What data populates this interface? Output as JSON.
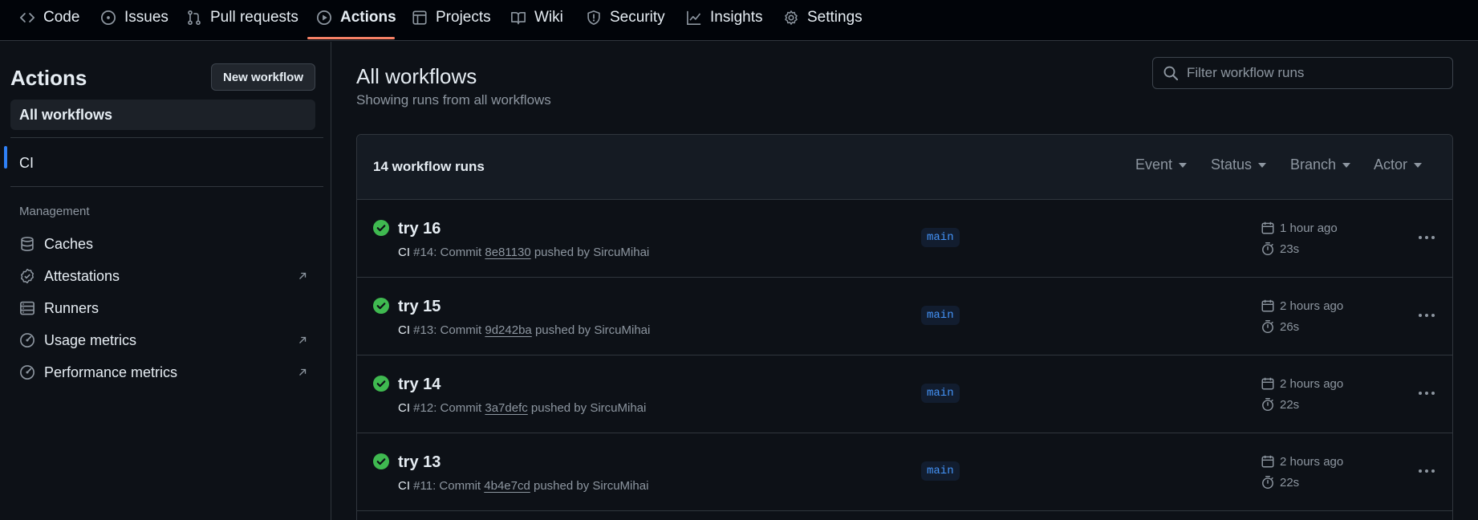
{
  "nav": {
    "tabs": [
      {
        "label": "Code",
        "icon": "code-icon"
      },
      {
        "label": "Issues",
        "icon": "issue-icon"
      },
      {
        "label": "Pull requests",
        "icon": "pull-request-icon"
      },
      {
        "label": "Actions",
        "icon": "play-icon",
        "active": true
      },
      {
        "label": "Projects",
        "icon": "table-icon"
      },
      {
        "label": "Wiki",
        "icon": "book-icon"
      },
      {
        "label": "Security",
        "icon": "shield-icon"
      },
      {
        "label": "Insights",
        "icon": "graph-icon"
      },
      {
        "label": "Settings",
        "icon": "gear-icon"
      }
    ],
    "active_color": "#f78166"
  },
  "sidebar": {
    "title": "Actions",
    "new_workflow_label": "New workflow",
    "all_workflows_label": "All workflows",
    "workflows": [
      "CI"
    ],
    "management_heading": "Management",
    "management_items": [
      {
        "label": "Caches",
        "icon": "database-icon",
        "external": false
      },
      {
        "label": "Attestations",
        "icon": "verified-icon",
        "external": true
      },
      {
        "label": "Runners",
        "icon": "server-icon",
        "external": false
      },
      {
        "label": "Usage metrics",
        "icon": "meter-icon",
        "external": true
      },
      {
        "label": "Performance metrics",
        "icon": "meter-icon",
        "external": true
      }
    ]
  },
  "main": {
    "title": "All workflows",
    "subtitle": "Showing runs from all workflows",
    "search_placeholder": "Filter workflow runs",
    "run_count": "14 workflow runs",
    "filters": [
      "Event",
      "Status",
      "Branch",
      "Actor"
    ],
    "runs": [
      {
        "title": "try 16",
        "workflow": "CI",
        "run_number": "#14",
        "commit_prefix": ": Commit ",
        "sha": "8e81130",
        "pushed_by": " pushed by SircuMihai",
        "branch": "main",
        "when": "1 hour ago",
        "duration": "23s",
        "status": "success"
      },
      {
        "title": "try 15",
        "workflow": "CI",
        "run_number": "#13",
        "commit_prefix": ": Commit ",
        "sha": "9d242ba",
        "pushed_by": " pushed by SircuMihai",
        "branch": "main",
        "when": "2 hours ago",
        "duration": "26s",
        "status": "success"
      },
      {
        "title": "try 14",
        "workflow": "CI",
        "run_number": "#12",
        "commit_prefix": ": Commit ",
        "sha": "3a7defc",
        "pushed_by": " pushed by SircuMihai",
        "branch": "main",
        "when": "2 hours ago",
        "duration": "22s",
        "status": "success"
      },
      {
        "title": "try 13",
        "workflow": "CI",
        "run_number": "#11",
        "commit_prefix": ": Commit ",
        "sha": "4b4e7cd",
        "pushed_by": " pushed by SircuMihai",
        "branch": "main",
        "when": "2 hours ago",
        "duration": "22s",
        "status": "success"
      }
    ],
    "success_color": "#3fb950",
    "branch_color": "#4493f8"
  }
}
